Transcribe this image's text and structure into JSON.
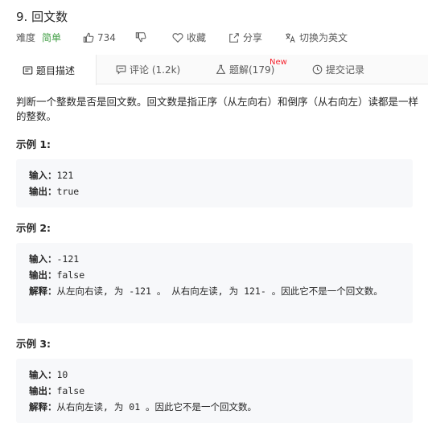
{
  "problem": {
    "title": "9. 回文数",
    "difficulty_label": "难度",
    "difficulty_value": "简单",
    "likes": "734",
    "favorite_label": "收藏",
    "share_label": "分享",
    "switch_lang_label": "切换为英文"
  },
  "tabs": [
    {
      "label": "题目描述",
      "icon": "document-icon"
    },
    {
      "label": "评论 (1.2k)",
      "icon": "comment-icon"
    },
    {
      "label": "题解(179)",
      "icon": "flask-icon",
      "badge": "New"
    },
    {
      "label": "提交记录",
      "icon": "clock-icon"
    }
  ],
  "description": {
    "text": "判断一个整数是否是回文数。回文数是指正序（从左向右）和倒序（从右向左）读都是一样的整数。"
  },
  "labels": {
    "input": "输入：",
    "output": "输出：",
    "explanation": "解释："
  },
  "examples": [
    {
      "title": "示例 1:",
      "input": "121",
      "output": "true",
      "explanation": ""
    },
    {
      "title": "示例 2:",
      "input": "-121",
      "output": "false",
      "explanation": "从左向右读, 为 -121 。 从右向左读, 为 121- 。因此它不是一个回文数。"
    },
    {
      "title": "示例 3:",
      "input": "10",
      "output": "false",
      "explanation": "从右向左读, 为 01 。因此它不是一个回文数。"
    }
  ],
  "colors": {
    "easy": "#43a047",
    "new_badge": "#f5222d",
    "code_bg": "#f7f8fa"
  }
}
